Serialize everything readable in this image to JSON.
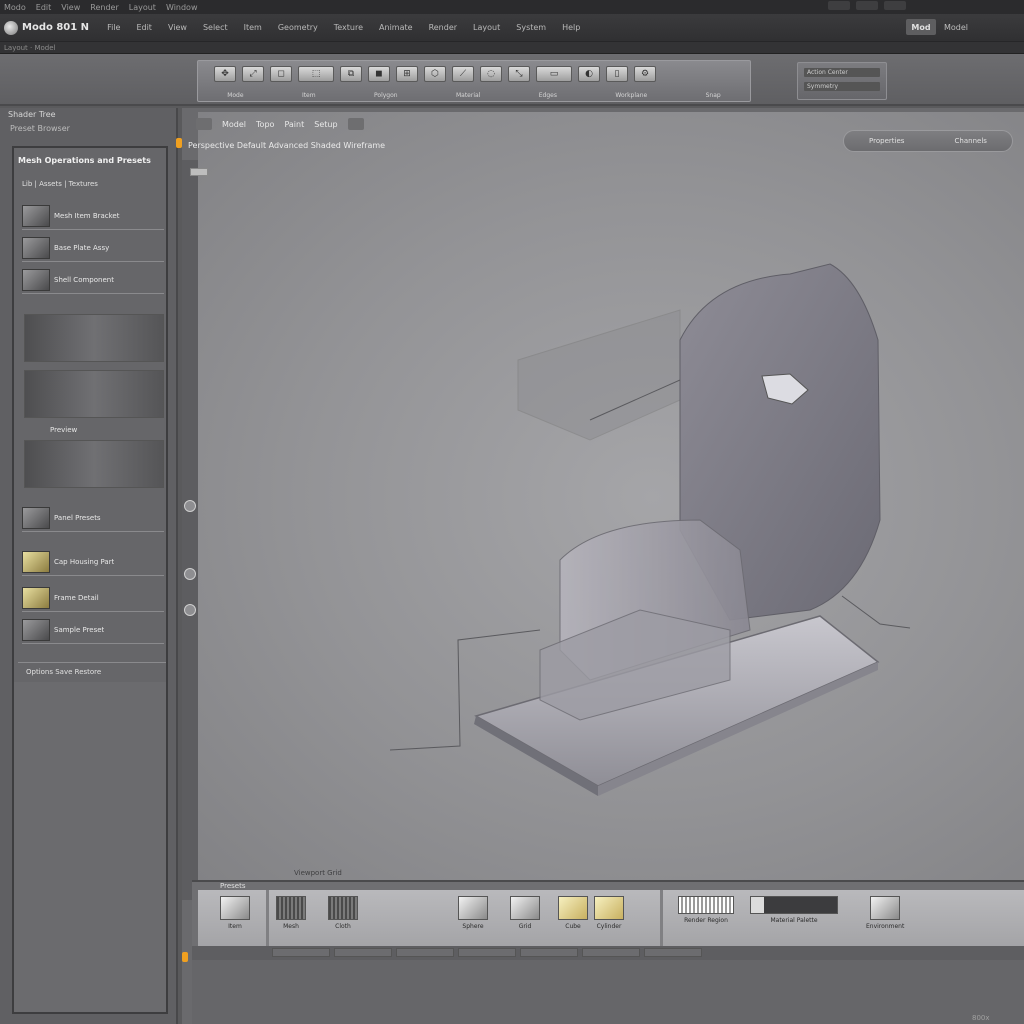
{
  "titlebar": {
    "items": [
      "Modo",
      "Edit",
      "View",
      "Render",
      "Layout",
      "Window"
    ],
    "window_controls": [
      "minimize",
      "maximize",
      "close"
    ]
  },
  "menubar": {
    "app_title": "Modo 801 N",
    "items": [
      "File",
      "Edit",
      "View",
      "Select",
      "Item",
      "Geometry",
      "Texture",
      "Animate",
      "Render",
      "Layout",
      "System",
      "Help"
    ],
    "right_button": "Mod",
    "right_label": "Model"
  },
  "subbar": {
    "text": "Layout · Model"
  },
  "ribbon": {
    "tools": [
      "✥",
      "⤢",
      "◻",
      "⬚",
      "⧉",
      "◼",
      "⊞",
      "⬡",
      "⟋",
      "◌",
      "⤡",
      "▭",
      "◐",
      "▯",
      "⚙"
    ],
    "captions": [
      "Mode",
      "Item",
      "Polygon",
      "Material",
      "Edges",
      "Workplane",
      "Snap"
    ],
    "right_rows": [
      "Action Center",
      "Symmetry"
    ]
  },
  "left_panel": {
    "head": "Shader Tree",
    "subhead": "Preset Browser",
    "panel_title": "Mesh Operations and Presets",
    "panel_subtitle": "Lib | Assets | Textures",
    "items": [
      {
        "label": "Mesh Item Bracket",
        "warm": false
      },
      {
        "label": "Base Plate Assy",
        "warm": false
      },
      {
        "label": "Shell Component",
        "warm": false
      }
    ],
    "section_label": "Preview",
    "items2": [
      {
        "label": "Panel Presets",
        "warm": false
      },
      {
        "label": "Cap Housing Part",
        "warm": true
      },
      {
        "label": "Frame Detail",
        "warm": true
      },
      {
        "label": "Sample Preset",
        "warm": false
      }
    ],
    "footer": "Options  Save  Restore"
  },
  "viewport": {
    "tabs": [
      "Model",
      "Topo",
      "Paint",
      "Setup"
    ],
    "info": "Perspective  Default  Advanced  Shaded  Wireframe",
    "right_pills": [
      "Properties",
      "Channels"
    ],
    "caption": "Viewport Grid"
  },
  "strip": {
    "title": "Presets",
    "assets": [
      {
        "label": "Item",
        "style": "light"
      },
      {
        "label": "Mesh",
        "style": "dark"
      },
      {
        "label": "Cloth",
        "style": "dark"
      },
      {
        "label": "Sphere",
        "style": "light"
      },
      {
        "label": "Grid",
        "style": "light"
      },
      {
        "label": "Cube",
        "style": "warm"
      },
      {
        "label": "Cylinder",
        "style": "warm"
      },
      {
        "label": "Render Region",
        "style": "bar"
      },
      {
        "label": "Material Palette",
        "style": "bar2"
      },
      {
        "label": "Environment",
        "style": "light"
      }
    ]
  },
  "status": {
    "corner": "800x"
  },
  "colors": {
    "accent": "#f0a020",
    "viewport": "#9c9c9f",
    "panel": "#666669"
  }
}
